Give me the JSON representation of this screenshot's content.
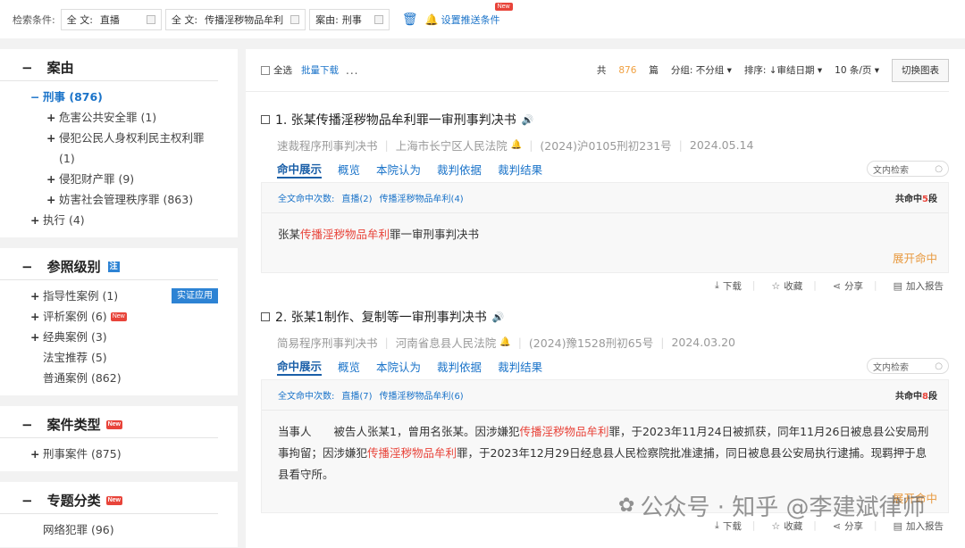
{
  "search_bar": {
    "label": "检索条件:",
    "chips": [
      {
        "key": "全 文:",
        "value": "直播"
      },
      {
        "key": "全 文:",
        "value": "传播淫秽物品牟利"
      },
      {
        "key": "案由:",
        "value": "刑事"
      }
    ],
    "push_label": "设置推送条件",
    "push_badge": "New"
  },
  "sidebar": {
    "case_cause": {
      "title": "案由",
      "root": "刑事 (876)",
      "children": [
        "危害公共安全罪 (1)",
        "侵犯公民人身权利民主权利罪 (1)",
        "侵犯财产罪 (9)",
        "妨害社会管理秩序罪 (863)"
      ],
      "other": "执行 (4)"
    },
    "reference_level": {
      "title": "参照级别",
      "note_badge": "注",
      "items": [
        "指导性案例 (1)",
        "评析案例 (6)",
        "经典案例 (3)",
        "法宝推荐 (5)",
        "普通案例 (862)"
      ],
      "apply_label": "实证应用",
      "new_badge": "New"
    },
    "case_type": {
      "title": "案件类型",
      "new_badge": "New",
      "items": [
        "刑事案件 (875)"
      ]
    },
    "topic": {
      "title": "专题分类",
      "new_badge": "New",
      "items": [
        "网络犯罪 (96)"
      ]
    }
  },
  "toolbar": {
    "select_all": "全选",
    "batch_download": "批量下载",
    "more": "...",
    "total_prefix": "共",
    "total_count": "876",
    "total_suffix": "篇",
    "group": "分组: 不分组 ▾",
    "sort": "排序: ↓审结日期 ▾",
    "page_size": "10 条/页 ▾",
    "switch_chart": "切换图表"
  },
  "results": [
    {
      "title": "1. 张某传播淫秽物品牟利罪一审刑事判决书",
      "procedure": "速裁程序刑事判决书",
      "court": "上海市长宁区人民法院",
      "case_no": "(2024)沪0105刑初231号",
      "date": "2024.05.14",
      "tabs": [
        "命中展示",
        "概览",
        "本院认为",
        "裁判依据",
        "裁判结果"
      ],
      "in_search": "文内检索",
      "hit_label": "全文命中次数:",
      "hit_terms": [
        "直播(2)",
        "传播淫秽物品牟利(4)"
      ],
      "hit_total_prefix": "共命中",
      "hit_total_n": "5",
      "hit_total_suffix": "段",
      "snippet": {
        "pre": "张某",
        "hl": "传播淫秽物品牟利",
        "post": "罪一审刑事判决书"
      },
      "expand": "展开命中",
      "actions": [
        "下载",
        "收藏",
        "分享",
        "加入报告"
      ]
    },
    {
      "title": "2. 张某1制作、复制等一审刑事判决书",
      "procedure": "简易程序刑事判决书",
      "court": "河南省息县人民法院",
      "case_no": "(2024)豫1528刑初65号",
      "date": "2024.03.20",
      "tabs": [
        "命中展示",
        "概览",
        "本院认为",
        "裁判依据",
        "裁判结果"
      ],
      "in_search": "文内检索",
      "hit_label": "全文命中次数:",
      "hit_terms": [
        "直播(7)",
        "传播淫秽物品牟利(6)"
      ],
      "hit_total_prefix": "共命中",
      "hit_total_n": "8",
      "hit_total_suffix": "段",
      "snippet": {
        "p1": "当事人　　被告人张某1，曾用名张某。因涉嫌犯",
        "h1": "传播淫秽物品牟利",
        "p2": "罪，于2023年11月24日被抓获，同年11月26日被息县公安局刑事拘留；因涉嫌犯",
        "h2": "传播淫秽物品牟利",
        "p3": "罪，于2023年12月29日经息县人民检察院批准逮捕，同日被息县公安局执行逮捕。现羁押于息县看守所。"
      },
      "expand": "展开命中",
      "actions": [
        "下载",
        "收藏",
        "分享",
        "加入报告"
      ]
    }
  ],
  "watermark": "公众号 · 知乎 @李建斌律师",
  "icons": {
    "trash": "trash-icon",
    "bell": "bell-icon",
    "speaker": "speaker-icon",
    "download": "download-icon",
    "star": "star-icon",
    "share": "share-icon",
    "report": "report-icon",
    "search": "search-icon"
  },
  "colors": {
    "accent": "#1a73c9",
    "highlight": "#e8443a",
    "expand": "#e89a40"
  }
}
